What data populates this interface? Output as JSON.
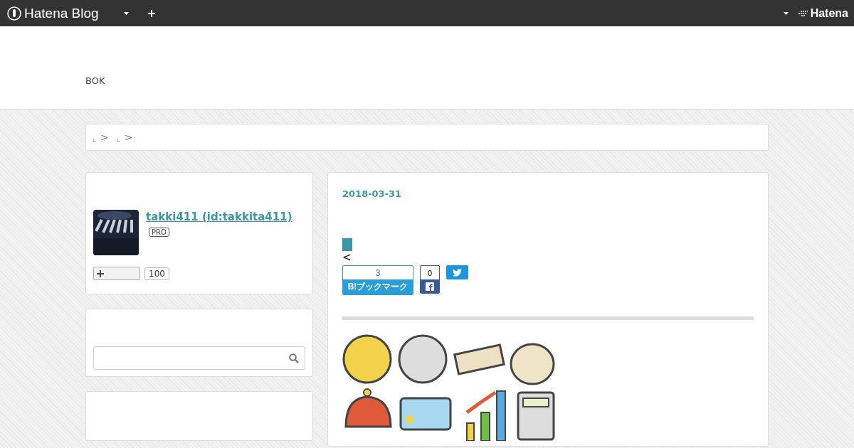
{
  "header": {
    "logo": "Hatena Blog",
    "brand": "Hatena"
  },
  "blog_title": "BOK",
  "breadcrumb": [
    {
      "separator": ">"
    },
    {
      "separator": ">"
    }
  ],
  "profile": {
    "name": "takki411 (id:takkita411)",
    "badge": "PRO",
    "follow_count": "100"
  },
  "entry": {
    "date": "2018-03-31",
    "arrow": "<",
    "bookmark": {
      "count": "3",
      "label": "B!ブックマーク"
    },
    "facebook": {
      "count": "0"
    }
  }
}
